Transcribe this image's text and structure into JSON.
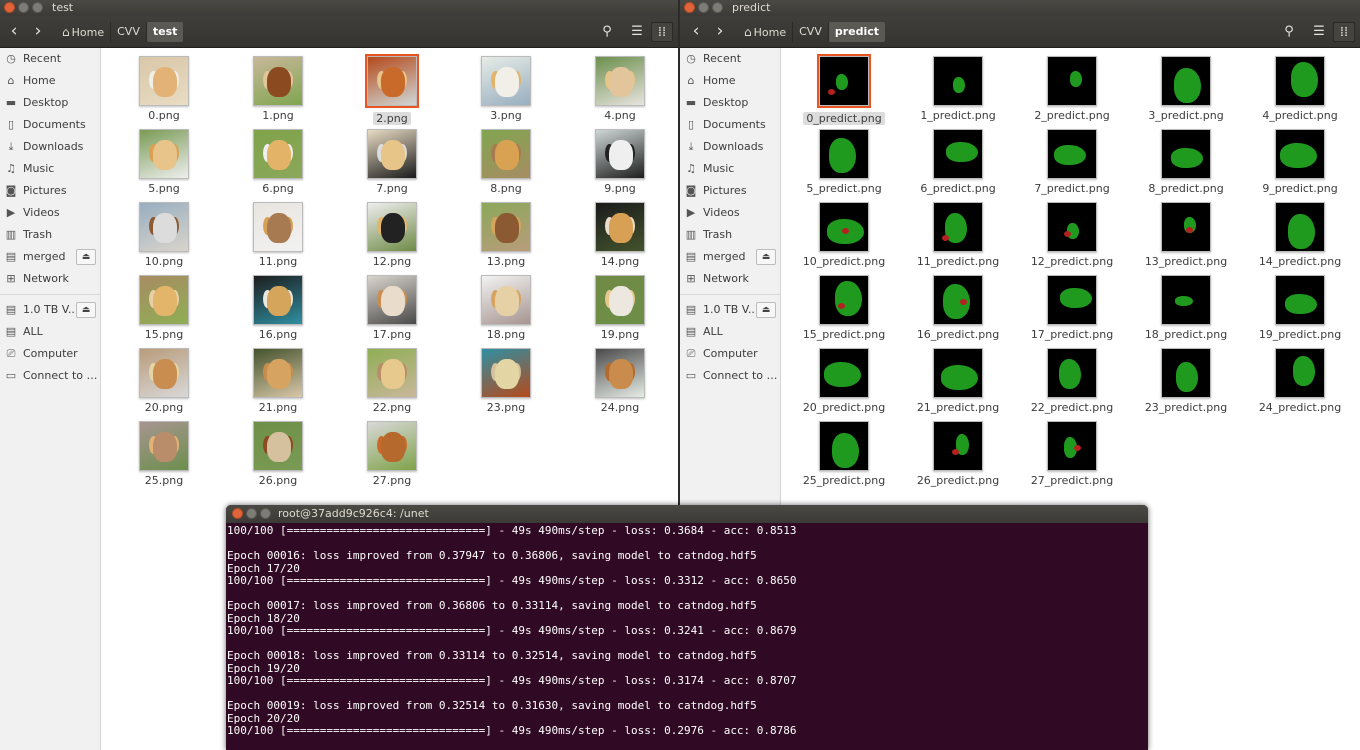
{
  "left_window": {
    "title": "test",
    "breadcrumbs": [
      "Home",
      "CVV",
      "test"
    ],
    "active_crumb": 2
  },
  "right_window": {
    "title": "predict",
    "breadcrumbs": [
      "Home",
      "CVV",
      "predict"
    ],
    "active_crumb": 2
  },
  "sidebar": {
    "items": [
      {
        "label": "Recent",
        "icon": "clock-icon"
      },
      {
        "label": "Home",
        "icon": "home-icon"
      },
      {
        "label": "Desktop",
        "icon": "folder-icon"
      },
      {
        "label": "Documents",
        "icon": "document-icon"
      },
      {
        "label": "Downloads",
        "icon": "download-icon"
      },
      {
        "label": "Music",
        "icon": "music-icon"
      },
      {
        "label": "Pictures",
        "icon": "camera-icon"
      },
      {
        "label": "Videos",
        "icon": "video-icon"
      },
      {
        "label": "Trash",
        "icon": "trash-icon"
      },
      {
        "label": "merged",
        "icon": "drive-icon",
        "eject": true
      },
      {
        "label": "Network",
        "icon": "network-icon"
      },
      {
        "label": "1.0 TB V...",
        "icon": "drive-icon",
        "eject": true,
        "sep_before": true
      },
      {
        "label": "ALL",
        "icon": "drive-icon"
      },
      {
        "label": "Computer",
        "icon": "computer-icon"
      },
      {
        "label": "Connect to S...",
        "icon": "server-icon"
      }
    ]
  },
  "test_files": [
    "0.png",
    "1.png",
    "2.png",
    "3.png",
    "4.png",
    "5.png",
    "6.png",
    "7.png",
    "8.png",
    "9.png",
    "10.png",
    "11.png",
    "12.png",
    "13.png",
    "14.png",
    "15.png",
    "16.png",
    "17.png",
    "18.png",
    "19.png",
    "20.png",
    "21.png",
    "22.png",
    "23.png",
    "24.png",
    "25.png",
    "26.png",
    "27.png"
  ],
  "test_selected_index": 2,
  "predict_files": [
    "0_predict.png",
    "1_predict.png",
    "2_predict.png",
    "3_predict.png",
    "4_predict.png",
    "5_predict.png",
    "6_predict.png",
    "7_predict.png",
    "8_predict.png",
    "9_predict.png",
    "10_predict.png",
    "11_predict.png",
    "12_predict.png",
    "13_predict.png",
    "14_predict.png",
    "15_predict.png",
    "16_predict.png",
    "17_predict.png",
    "18_predict.png",
    "19_predict.png",
    "20_predict.png",
    "21_predict.png",
    "22_predict.png",
    "23_predict.png",
    "24_predict.png",
    "25_predict.png",
    "26_predict.png",
    "27_predict.png"
  ],
  "predict_selected_index": 0,
  "terminal": {
    "title": "root@37add9c926c4: /unet",
    "lines": [
      "100/100 [==============================] - 49s 490ms/step - loss: 0.3684 - acc: 0.8513",
      "",
      "Epoch 00016: loss improved from 0.37947 to 0.36806, saving model to catndog.hdf5",
      "Epoch 17/20",
      "100/100 [==============================] - 49s 490ms/step - loss: 0.3312 - acc: 0.8650",
      "",
      "Epoch 00017: loss improved from 0.36806 to 0.33114, saving model to catndog.hdf5",
      "Epoch 18/20",
      "100/100 [==============================] - 49s 490ms/step - loss: 0.3241 - acc: 0.8679",
      "",
      "Epoch 00018: loss improved from 0.33114 to 0.32514, saving model to catndog.hdf5",
      "Epoch 19/20",
      "100/100 [==============================] - 49s 490ms/step - loss: 0.3174 - acc: 0.8707",
      "",
      "Epoch 00019: loss improved from 0.32514 to 0.31630, saving model to catndog.hdf5",
      "Epoch 20/20",
      "100/100 [==============================] - 49s 490ms/step - loss: 0.2976 - acc: 0.8786"
    ]
  },
  "colors": {
    "accent": "#e95420",
    "terminal_bg": "#300a24",
    "mask_green": "#1f9a1f",
    "mask_red": "#b52020"
  }
}
